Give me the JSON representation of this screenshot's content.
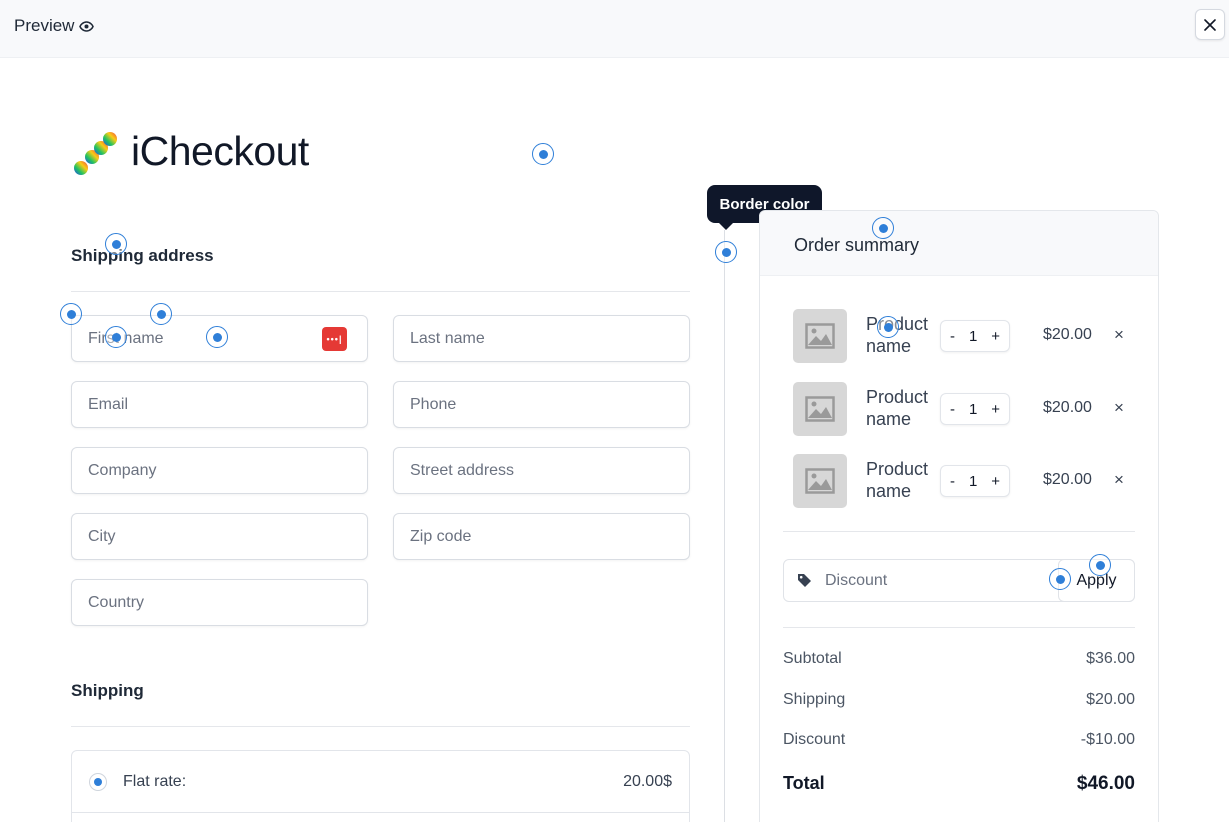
{
  "topbar": {
    "title": "Preview"
  },
  "brand": {
    "name": "iCheckout"
  },
  "shipping_address": {
    "title": "Shipping address",
    "fields": [
      {
        "id": "first-name",
        "placeholder": "First name"
      },
      {
        "id": "last-name",
        "placeholder": "Last name"
      },
      {
        "id": "email",
        "placeholder": "Email"
      },
      {
        "id": "phone",
        "placeholder": "Phone"
      },
      {
        "id": "company",
        "placeholder": "Company"
      },
      {
        "id": "street-address",
        "placeholder": "Street address"
      },
      {
        "id": "city",
        "placeholder": "City"
      },
      {
        "id": "zip-code",
        "placeholder": "Zip code"
      },
      {
        "id": "country",
        "placeholder": "Country"
      }
    ],
    "password_manager_badge": "•••|"
  },
  "shipping": {
    "title": "Shipping",
    "rates": [
      {
        "label": "Flat rate:",
        "price": "20.00$",
        "selected": true
      }
    ]
  },
  "tooltip": {
    "text": "Border color"
  },
  "order_summary": {
    "title": "Order summary",
    "items": [
      {
        "name": "Product name",
        "qty": "1",
        "price": "$20.00",
        "minus": "-",
        "plus": "+",
        "remove": "×"
      },
      {
        "name": "Product name",
        "qty": "1",
        "price": "$20.00",
        "minus": "-",
        "plus": "+",
        "remove": "×"
      },
      {
        "name": "Product name",
        "qty": "1",
        "price": "$20.00",
        "minus": "-",
        "plus": "+",
        "remove": "×"
      }
    ],
    "discount": {
      "placeholder": "Discount",
      "apply_label": "Apply"
    },
    "totals": {
      "subtotal_label": "Subtotal",
      "subtotal": "$36.00",
      "shipping_label": "Shipping",
      "shipping": "$20.00",
      "discount_label": "Discount",
      "discount": "-$10.00",
      "total_label": "Total",
      "total": "$46.00"
    }
  },
  "colors": {
    "accent": "#2f7fd8",
    "tooltip_bg": "#0f172a",
    "password_badge": "#e53935",
    "thumb_bg": "#d7d7d7"
  },
  "icons": [
    "eye-icon",
    "close-icon",
    "image-placeholder-icon",
    "tag-icon",
    "password-manager-icon"
  ]
}
